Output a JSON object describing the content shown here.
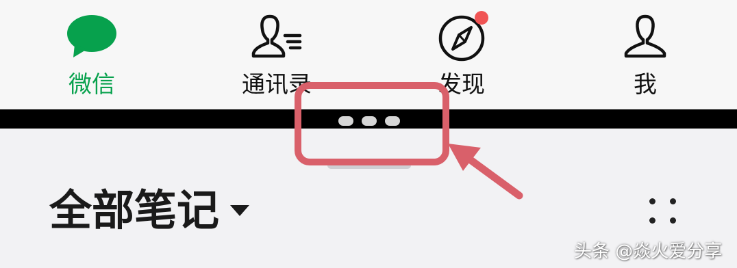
{
  "tabbar": {
    "tabs": [
      {
        "label": "微信",
        "icon": "chat-bubble-icon",
        "active": true
      },
      {
        "label": "通讯录",
        "icon": "contacts-icon",
        "active": false
      },
      {
        "label": "发现",
        "icon": "compass-icon",
        "active": false,
        "badge": "red-dot"
      },
      {
        "label": "我",
        "icon": "person-icon",
        "active": false
      }
    ]
  },
  "panel": {
    "title": "全部笔记",
    "title_dropdown_icon": "caret-down-icon",
    "view_toggle_icon": "grid-dots-icon"
  },
  "watermark": "头条 @焱火爱分享",
  "colors": {
    "active_tab": "#07a14d",
    "annotation": "#d9606a",
    "badge": "#f05454",
    "strip": "#000000"
  }
}
